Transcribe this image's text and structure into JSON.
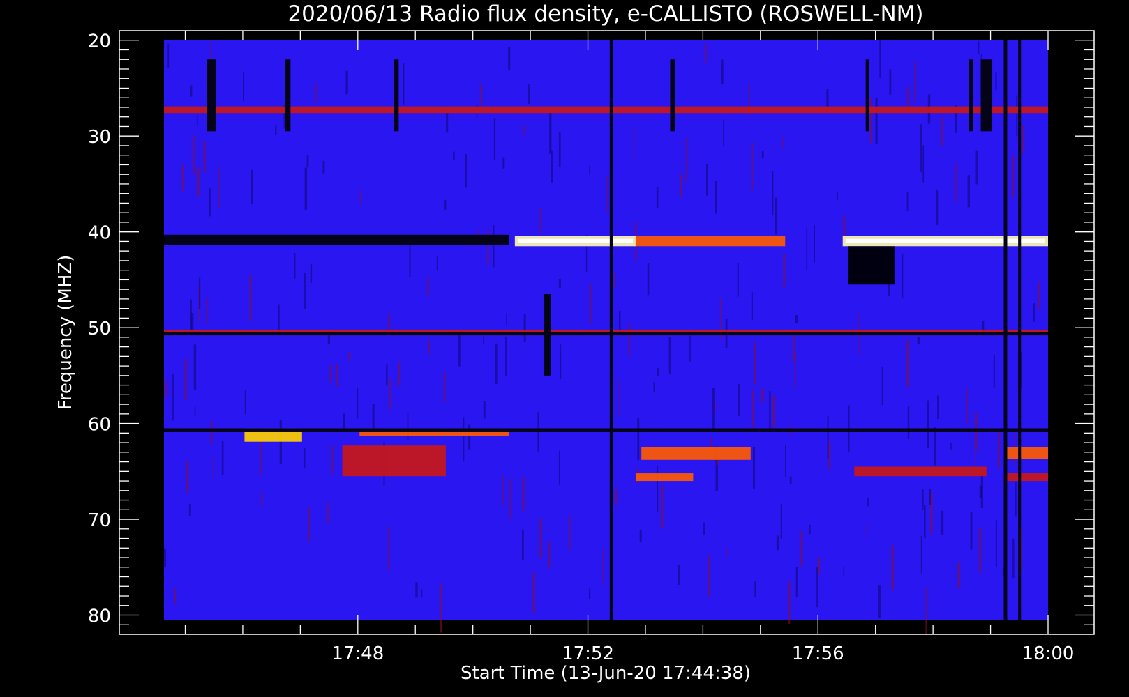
{
  "chart_data": {
    "type": "heatmap",
    "title": "2020/06/13  Radio flux density, e-CALLISTO (ROSWELL-NM)",
    "xlabel": "Start Time (13-Jun-20 17:44:38)",
    "ylabel": "Frequency (MHZ)",
    "x_ticks": [
      "17:48",
      "17:52",
      "17:56",
      "18:00"
    ],
    "x_tick_minutes": [
      3.37,
      7.37,
      11.37,
      15.37
    ],
    "xlim_minutes": [
      0,
      15.37
    ],
    "y_ticks": [
      20,
      30,
      40,
      50,
      60,
      70,
      80
    ],
    "ylim": [
      19,
      82
    ],
    "data_freq_range": [
      20,
      80.5
    ],
    "y_inverted": true,
    "colormap": [
      "#000000",
      "#1a10c8",
      "#2a16f0",
      "#b01010",
      "#ff3000",
      "#ffd000",
      "#ffffe0"
    ],
    "background_color": "#2a16f0",
    "features": [
      {
        "kind": "dark-band",
        "t": [
          0,
          6
        ],
        "f": [
          40.3,
          41.4
        ]
      },
      {
        "kind": "bright-band",
        "t": [
          6.1,
          8.2
        ],
        "f": [
          40.4,
          41.5
        ],
        "level": 1.0
      },
      {
        "kind": "bright-band",
        "t": [
          8.2,
          10.8
        ],
        "f": [
          40.4,
          41.5
        ],
        "level": 0.6
      },
      {
        "kind": "bright-band",
        "t": [
          11.8,
          15.37
        ],
        "f": [
          40.4,
          41.5
        ],
        "level": 1.0
      },
      {
        "kind": "dark-blob",
        "t": [
          11.9,
          12.7
        ],
        "f": [
          41.5,
          45.5
        ]
      },
      {
        "kind": "bright-band",
        "t": [
          0,
          15.37
        ],
        "f": [
          26.9,
          27.6
        ],
        "level": 0.55
      },
      {
        "kind": "bright-band",
        "t": [
          0,
          15.37
        ],
        "f": [
          50.2,
          50.8
        ],
        "level": 0.55
      },
      {
        "kind": "bright-band",
        "t": [
          1.4,
          2.4
        ],
        "f": [
          60.5,
          61.9
        ],
        "level": 0.85
      },
      {
        "kind": "bright-band",
        "t": [
          3.4,
          6.0
        ],
        "f": [
          60.5,
          61.3
        ],
        "level": 0.6
      },
      {
        "kind": "bright-band",
        "t": [
          3.1,
          4.9
        ],
        "f": [
          62.3,
          65.5
        ],
        "level": 0.55
      },
      {
        "kind": "bright-band",
        "t": [
          8.3,
          10.2
        ],
        "f": [
          62.5,
          63.8
        ],
        "level": 0.7
      },
      {
        "kind": "bright-band",
        "t": [
          8.2,
          9.2
        ],
        "f": [
          65.2,
          66.0
        ],
        "level": 0.7
      },
      {
        "kind": "bright-band",
        "t": [
          12.0,
          14.3
        ],
        "f": [
          64.5,
          65.5
        ],
        "level": 0.55
      },
      {
        "kind": "bright-band",
        "t": [
          14.6,
          15.37
        ],
        "f": [
          62.5,
          63.7
        ],
        "level": 0.6
      },
      {
        "kind": "bright-band",
        "t": [
          14.6,
          15.37
        ],
        "f": [
          65.2,
          66.0
        ],
        "level": 0.55
      },
      {
        "kind": "dark-line",
        "t": [
          0,
          15.37
        ],
        "f": [
          60.5,
          60.9
        ]
      },
      {
        "kind": "dark-line",
        "t": [
          0,
          15.37
        ],
        "f": [
          50.5,
          50.8
        ]
      },
      {
        "kind": "dark-line",
        "t": [
          7.75,
          7.8
        ],
        "f": [
          20,
          80.5
        ]
      },
      {
        "kind": "dark-line",
        "t": [
          14.6,
          14.66
        ],
        "f": [
          20,
          80.5
        ]
      },
      {
        "kind": "dark-line",
        "t": [
          14.85,
          14.9
        ],
        "f": [
          20,
          80.5
        ]
      },
      {
        "kind": "dark-line",
        "t": [
          0.75,
          0.9
        ],
        "f": [
          22,
          29.5
        ]
      },
      {
        "kind": "dark-line",
        "t": [
          2.1,
          2.2
        ],
        "f": [
          22,
          29.5
        ]
      },
      {
        "kind": "dark-line",
        "t": [
          4.0,
          4.08
        ],
        "f": [
          22,
          29.5
        ]
      },
      {
        "kind": "dark-line",
        "t": [
          8.8,
          8.88
        ],
        "f": [
          22,
          29.5
        ]
      },
      {
        "kind": "dark-line",
        "t": [
          12.2,
          12.26
        ],
        "f": [
          22,
          29.5
        ]
      },
      {
        "kind": "dark-line",
        "t": [
          14.0,
          14.06
        ],
        "f": [
          22,
          29.5
        ]
      },
      {
        "kind": "dark-line",
        "t": [
          14.2,
          14.4
        ],
        "f": [
          22,
          29.5
        ]
      },
      {
        "kind": "dark-line",
        "t": [
          6.6,
          6.72
        ],
        "f": [
          46.5,
          55
        ]
      }
    ]
  }
}
